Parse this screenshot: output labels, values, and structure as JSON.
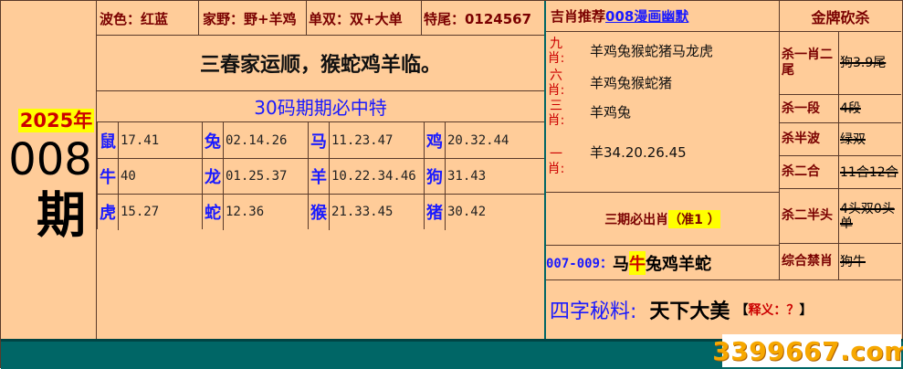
{
  "colors": {
    "panel": "#ffcc99",
    "teal": "#006666",
    "red": "#cc0000",
    "blue": "#1a1aff",
    "dark": "#7a0000"
  },
  "period": {
    "year": "2025年",
    "num": "008",
    "qi": "期"
  },
  "top_info": {
    "bose": "波色：红蓝",
    "jiaye": "家野：野+羊鸡",
    "danshuang": "单双：双+大单",
    "tewei": "特尾：0124567"
  },
  "verse": "三春家运顺，猴蛇鸡羊临。",
  "code_title": "30码期期必中特",
  "zodiac_grid": [
    [
      {
        "z": "鼠",
        "n": "17.41"
      },
      {
        "z": "兔",
        "n": "02.14.26"
      },
      {
        "z": "马",
        "n": "11.23.47"
      },
      {
        "z": "鸡",
        "n": "20.32.44"
      }
    ],
    [
      {
        "z": "牛",
        "n": "40"
      },
      {
        "z": "龙",
        "n": "01.25.37"
      },
      {
        "z": "羊",
        "n": "10.22.34.46"
      },
      {
        "z": "狗",
        "n": "31.43"
      }
    ],
    [
      {
        "z": "虎",
        "n": "15.27"
      },
      {
        "z": "蛇",
        "n": "12.36"
      },
      {
        "z": "猴",
        "n": "21.33.45"
      },
      {
        "z": "猪",
        "n": "30.42"
      }
    ]
  ],
  "right_header": {
    "prefix": "吉肖推荐",
    "link": "008漫画幽默",
    "right": "金牌砍杀"
  },
  "picks": [
    {
      "label": "九肖:",
      "text": "羊鸡兔猴蛇猪马龙虎"
    },
    {
      "label": "六肖:",
      "text": "羊鸡兔猴蛇猪"
    },
    {
      "label": "三肖:",
      "text": "羊鸡兔"
    },
    {
      "label": "一肖:",
      "text": "羊34.20.26.45"
    }
  ],
  "sanqi": {
    "label": "三期必出肖",
    "note": "（准1 ）"
  },
  "range": {
    "label": "007-009：",
    "pre": "马",
    "hl": "牛",
    "post": "兔鸡羊蛇"
  },
  "kills": [
    {
      "label": "杀一肖二尾",
      "value": "狗3.9尾"
    },
    {
      "label": "杀一段",
      "value": "4段"
    },
    {
      "label": "杀半波",
      "value": "绿双"
    },
    {
      "label": "杀二合",
      "value": "11合12合"
    },
    {
      "label": "杀二半头",
      "value": "4头双0头单"
    },
    {
      "label": "综合禁肖",
      "value": "狗牛"
    }
  ],
  "secret": {
    "label": "四字秘料:",
    "value": "天下大美",
    "note_l": "【",
    "note": "释义：？",
    "note_r": "】"
  },
  "watermark": "3399667.com"
}
